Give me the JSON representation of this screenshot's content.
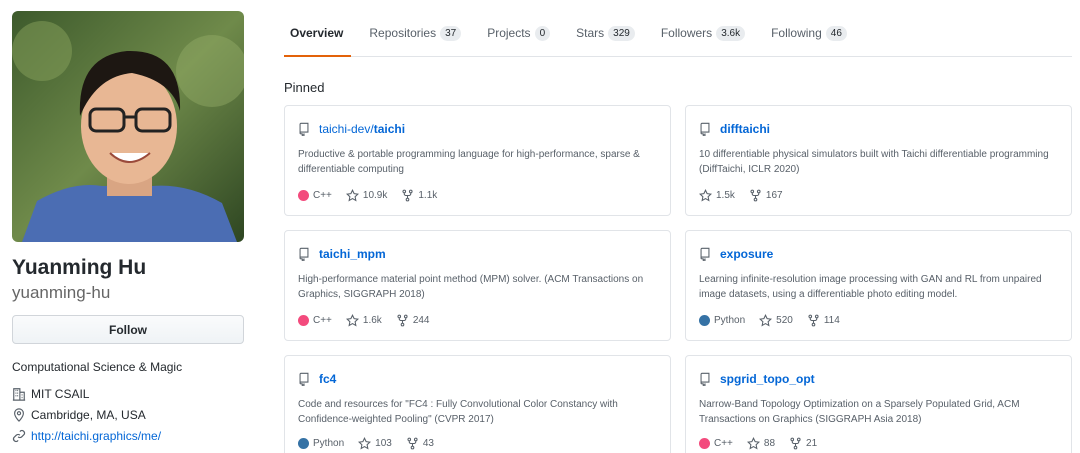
{
  "profile": {
    "fullname": "Yuanming Hu",
    "username": "yuanming-hu",
    "follow_label": "Follow",
    "bio": "Computational Science & Magic",
    "organization": "MIT CSAIL",
    "location": "Cambridge, MA, USA",
    "website": "http://taichi.graphics/me/"
  },
  "tabs": [
    {
      "label": "Overview",
      "count": ""
    },
    {
      "label": "Repositories",
      "count": "37"
    },
    {
      "label": "Projects",
      "count": "0"
    },
    {
      "label": "Stars",
      "count": "329"
    },
    {
      "label": "Followers",
      "count": "3.6k"
    },
    {
      "label": "Following",
      "count": "46"
    }
  ],
  "pinned_title": "Pinned",
  "colors": {
    "accent_tab": "#e36209",
    "link": "#0366d6",
    "cpp": "#f34b7d",
    "python": "#3572A5"
  },
  "repos": [
    {
      "owner": "taichi-dev/",
      "name": "taichi",
      "description": "Productive & portable programming language for high-performance, sparse & differentiable computing",
      "language": "C++",
      "stars": "10.9k",
      "forks": "1.1k"
    },
    {
      "owner": "",
      "name": "difftaichi",
      "description": "10 differentiable physical simulators built with Taichi differentiable programming (DiffTaichi, ICLR 2020)",
      "language": "",
      "stars": "1.5k",
      "forks": "167"
    },
    {
      "owner": "",
      "name": "taichi_mpm",
      "description": "High-performance material point method (MPM) solver. (ACM Transactions on Graphics, SIGGRAPH 2018)",
      "language": "C++",
      "stars": "1.6k",
      "forks": "244"
    },
    {
      "owner": "",
      "name": "exposure",
      "description": "Learning infinite-resolution image processing with GAN and RL from unpaired image datasets, using a differentiable photo editing model.",
      "language": "Python",
      "stars": "520",
      "forks": "114"
    },
    {
      "owner": "",
      "name": "fc4",
      "description": "Code and resources for \"FC4 : Fully Convolutional Color Constancy with Confidence-weighted Pooling\" (CVPR 2017)",
      "language": "Python",
      "stars": "103",
      "forks": "43"
    },
    {
      "owner": "",
      "name": "spgrid_topo_opt",
      "description": "Narrow-Band Topology Optimization on a Sparsely Populated Grid, ACM Transactions on Graphics (SIGGRAPH Asia 2018)",
      "language": "C++",
      "stars": "88",
      "forks": "21"
    }
  ]
}
